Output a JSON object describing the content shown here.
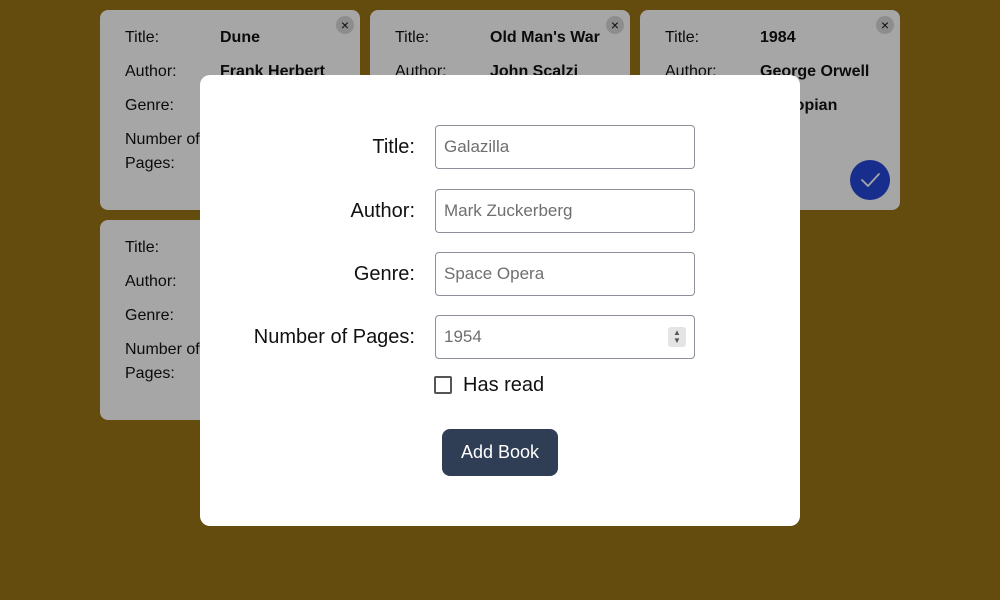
{
  "labels": {
    "title": "Title:",
    "author": "Author:",
    "genre": "Genre:",
    "pages_line1": "Number of",
    "pages_line2": "Pages:"
  },
  "books": [
    {
      "title": "Dune",
      "author": "Frank Herbert",
      "genre": "",
      "pages": "",
      "read": false
    },
    {
      "title": "Old Man's War",
      "author": "John Scalzi",
      "genre": "",
      "pages": "",
      "read": false
    },
    {
      "title": "1984",
      "author": "George Orwell",
      "genre": "Dystopian",
      "pages": "",
      "read": true
    },
    {
      "title": "",
      "author": "",
      "genre": "",
      "pages": "",
      "read": false
    }
  ],
  "card_close_symbol": "×",
  "read_button_icon": "check-icon",
  "modal": {
    "title_label": "Title:",
    "title_placeholder": "Galazilla",
    "author_label": "Author:",
    "author_placeholder": "Mark Zuckerberg",
    "genre_label": "Genre:",
    "genre_placeholder": "Space Opera",
    "pages_label": "Number of Pages:",
    "pages_placeholder": "1954",
    "has_read_label": "Has read",
    "has_read_checked": false,
    "submit_label": "Add Book"
  },
  "colors": {
    "page_background": "#9a7416",
    "card_background": "#ffffff",
    "read_button": "#2448d8",
    "submit_button": "#2f3e54"
  }
}
